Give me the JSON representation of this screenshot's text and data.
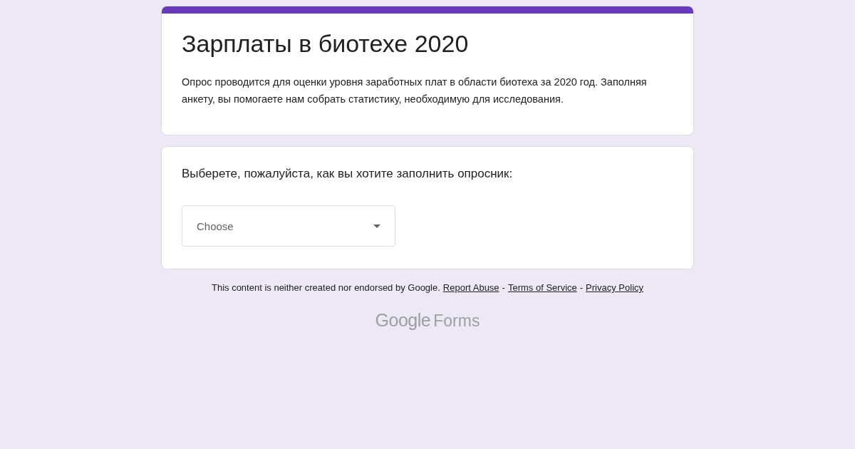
{
  "header": {
    "title": "Зарплаты в биотехе 2020",
    "description": "Опрос проводится для оценки уровня заработных плат в области биотеха за 2020 год. Заполняя анкету, вы помогаете нам собрать статистику, необходимую для исследования."
  },
  "question": {
    "text": "Выберете, пожалуйста, как вы хотите заполнить опросник:",
    "dropdown": {
      "placeholder": "Choose"
    }
  },
  "footer": {
    "notice": "This content is neither created nor endorsed by Google.",
    "links": [
      "Report Abuse",
      "Terms of Service",
      "Privacy Policy"
    ],
    "separator": "-"
  },
  "logo": {
    "brand": "Google",
    "product": "Forms"
  }
}
